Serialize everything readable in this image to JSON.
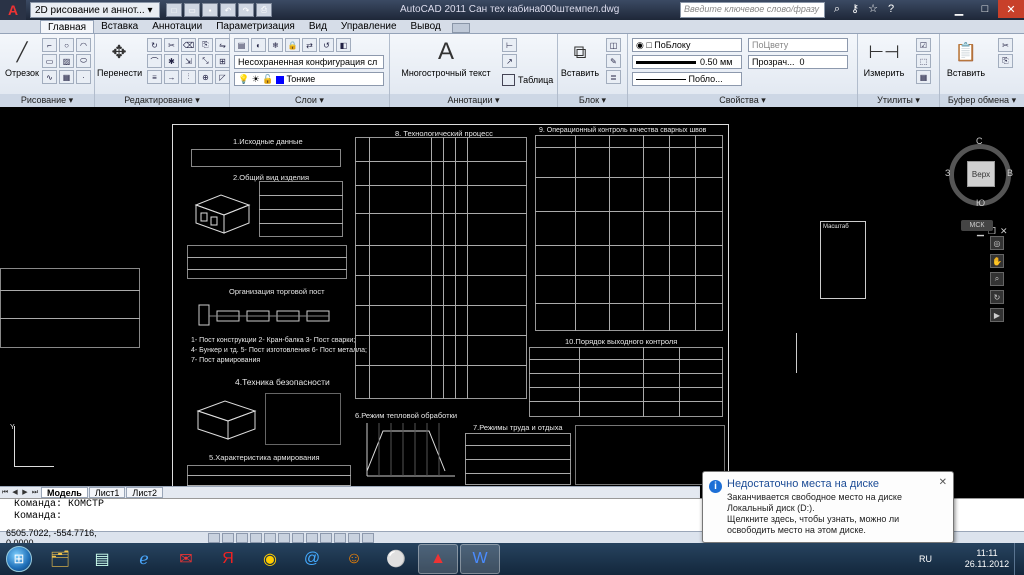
{
  "titlebar": {
    "workspace": "2D рисование и аннот...",
    "title": "AutoCAD 2011    Сан тех кабина000штемпел.dwg",
    "search_placeholder": "Введите ключевое слово/фразу"
  },
  "tabs": [
    "Главная",
    "Вставка",
    "Аннотации",
    "Параметризация",
    "Вид",
    "Управление",
    "Вывод"
  ],
  "ribbon": {
    "draw": {
      "label": "Рисование",
      "line": "Отрезок"
    },
    "modify": {
      "label": "Редактирование",
      "move": "Перенести"
    },
    "layers": {
      "label": "Слои",
      "config": "Несохраненная конфигурация сл",
      "layer": "Тонкие"
    },
    "annotation": {
      "label": "Аннотации",
      "mtext": "Многострочный текст",
      "table": "Таблица"
    },
    "block": {
      "label": "Блок",
      "insert": "Вставить"
    },
    "properties": {
      "label": "Свойства",
      "color": "ПоБлоку",
      "linetype_layer": "ПоЦвету",
      "lineweight": "0.50 мм",
      "linetype": "Побло...",
      "transparency": "Прозрач...",
      "transparency_value": "0"
    },
    "utilities": {
      "label": "Утилиты",
      "measure": "Измерить"
    },
    "clipboard": {
      "label": "Буфер обмена",
      "paste": "Вставить"
    }
  },
  "drawing": {
    "h_initial": "1.Исходные данные",
    "h_tech_process": "8. Технологический процесс",
    "h_quality": "9. Операционный контроль качества сварных швов",
    "h_general": "2.Общий вид изделия",
    "h_cargo": "Организация торговой пост",
    "h_safety": "4.Техника безопасности",
    "h_reinf": "5.Характеристика армирования",
    "h_thermal": "6.Режим тепловой обработки",
    "h_labor": "7.Режимы труда и отдыха",
    "h_output": "10.Порядок выходного контроля",
    "legend_lines": [
      "1- Пост конструкции 2- Кран-балка 3- Пост сварки;",
      "4- Бункер и тд. 5- Пост изготовления 6- Пост металла;",
      "7- Пост армирования"
    ],
    "stamp": "Масштаб"
  },
  "viewcube": {
    "top": "Верх",
    "n": "С",
    "s": "Ю",
    "w": "З",
    "e": "В",
    "wcs": "МСК"
  },
  "layout_tabs": [
    "Модель",
    "Лист1",
    "Лист2"
  ],
  "cmd": {
    "line1": "Команда: КОМСТР",
    "line2": "Команда:"
  },
  "status": {
    "coords": "6505.7022, -554.7716, 0.0000"
  },
  "notification": {
    "title": "Недостаточно места на диске",
    "body1": "Заканчивается свободное место на диске Локальный диск (D:).",
    "body2": "Щелкните здесь, чтобы узнать, можно ли освободить место на этом диске."
  },
  "tray": {
    "lang": "RU",
    "time": "11:11",
    "date": "26.11.2012"
  }
}
